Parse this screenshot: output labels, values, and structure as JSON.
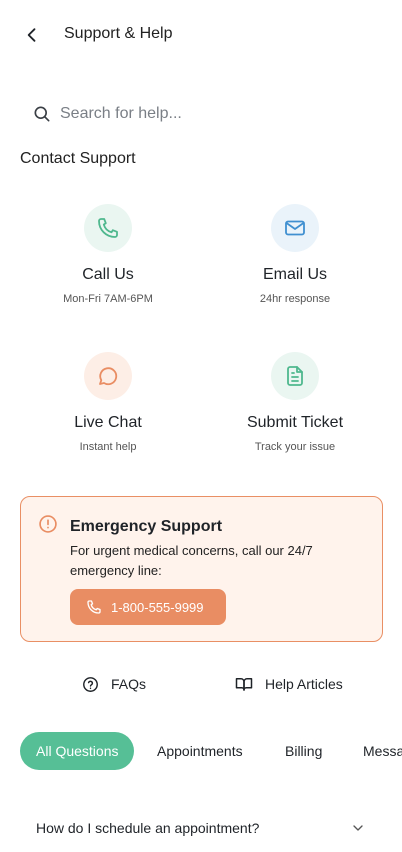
{
  "header": {
    "title": "Support & Help",
    "back_icon": "chevron-left-icon"
  },
  "search": {
    "placeholder": "Search for help...",
    "value": "",
    "icon": "search-icon"
  },
  "contact": {
    "section_title": "Contact Support",
    "options": [
      {
        "title": "Call Us",
        "subtitle": "Mon-Fri 7AM-6PM",
        "icon": "phone-icon",
        "icon_bg": "#eaf6f1",
        "icon_color": "#4fb88e"
      },
      {
        "title": "Email Us",
        "subtitle": "24hr response",
        "icon": "mail-icon",
        "icon_bg": "#eaf3fa",
        "icon_color": "#3f8fd0"
      },
      {
        "title": "Live Chat",
        "subtitle": "Instant help",
        "icon": "chat-icon",
        "icon_bg": "#fdeee6",
        "icon_color": "#e98d63"
      },
      {
        "title": "Submit Ticket",
        "subtitle": "Track your issue",
        "icon": "document-icon",
        "icon_bg": "#eaf6f1",
        "icon_color": "#4fb88e"
      }
    ]
  },
  "emergency": {
    "title": "Emergency Support",
    "text": "For urgent medical concerns, call our 24/7 emergency line:",
    "phone": "1-800-555-9999",
    "icon": "alert-circle-icon",
    "accent": "#e98d63",
    "background": "#fff3ec"
  },
  "quick_links": [
    {
      "label": "FAQs",
      "icon": "help-circle-icon"
    },
    {
      "label": "Help Articles",
      "icon": "book-open-icon"
    }
  ],
  "tabs": [
    {
      "label": "All Questions",
      "active": true
    },
    {
      "label": "Appointments",
      "active": false
    },
    {
      "label": "Billing",
      "active": false
    },
    {
      "label": "Messages",
      "active": false
    }
  ],
  "faqs": [
    {
      "question": "How do I schedule an appointment?",
      "expanded": false,
      "icon": "chevron-down-icon"
    }
  ],
  "colors": {
    "primary": "#56bf96",
    "accent": "#e98d63"
  }
}
